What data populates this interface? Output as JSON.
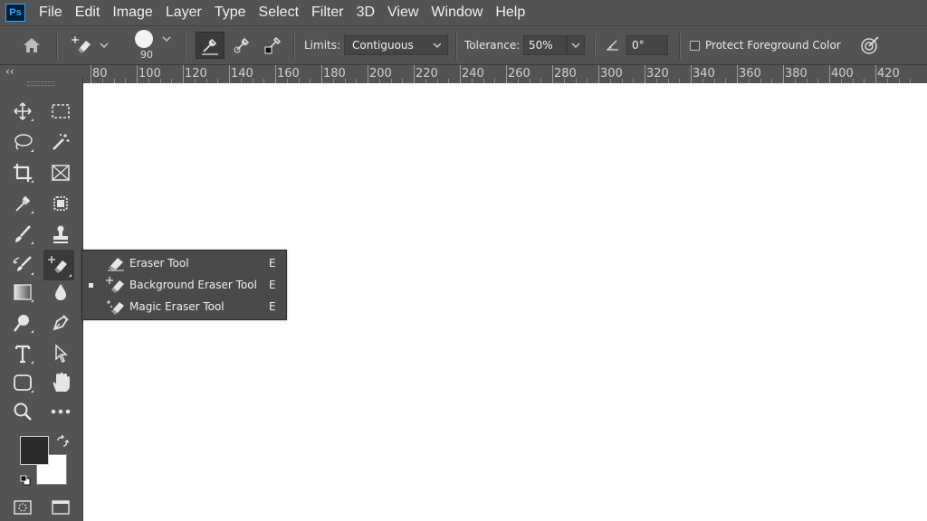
{
  "app": {
    "logo": "Ps"
  },
  "menu": [
    "File",
    "Edit",
    "Image",
    "Layer",
    "Type",
    "Select",
    "Filter",
    "3D",
    "View",
    "Window",
    "Help"
  ],
  "options": {
    "brush_size": "90",
    "limits_label": "Limits:",
    "limits_value": "Contiguous",
    "tolerance_label": "Tolerance:",
    "tolerance_value": "50%",
    "angle_value": "0°",
    "protect_label": "Protect Foreground Color",
    "protect_checked": false
  },
  "ruler": {
    "labels": [
      "80",
      "100",
      "120",
      "140",
      "160",
      "180",
      "200",
      "220",
      "240",
      "260",
      "280",
      "300",
      "320",
      "340",
      "360",
      "380",
      "400",
      "420"
    ]
  },
  "flyout": {
    "items": [
      {
        "name": "Eraser Tool",
        "key": "E",
        "selected": false,
        "icon": "eraser-icon"
      },
      {
        "name": "Background Eraser Tool",
        "key": "E",
        "selected": true,
        "icon": "background-eraser-icon"
      },
      {
        "name": "Magic Eraser Tool",
        "key": "E",
        "selected": false,
        "icon": "magic-eraser-icon"
      }
    ]
  },
  "colors": {
    "foreground": "#2b2b2b",
    "background": "#ffffff",
    "accent": "#31a8ff"
  },
  "toolbar": {
    "collapse_glyph": "‹‹"
  }
}
